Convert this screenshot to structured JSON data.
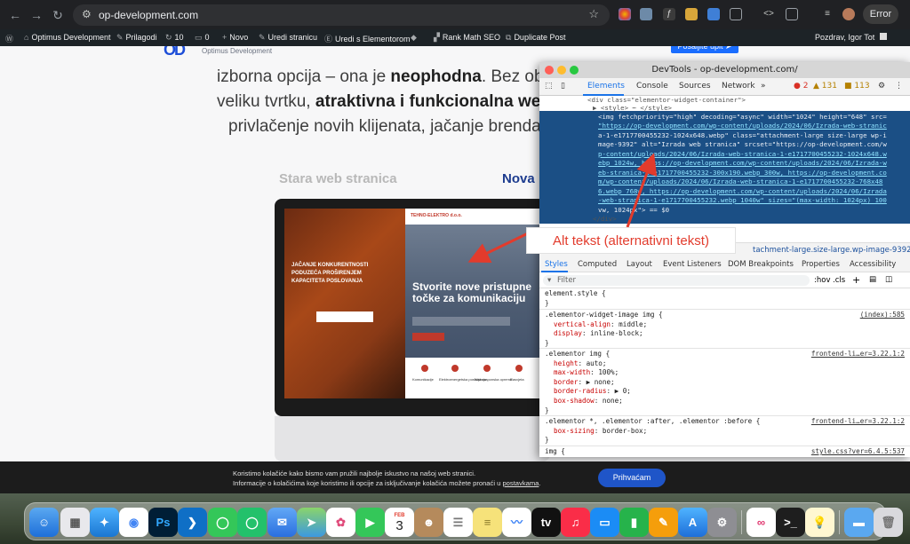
{
  "browser": {
    "url": "op-development.com",
    "profile_button": "Error"
  },
  "admin_bar": {
    "site_name": "Optimus Development",
    "customize": "Prilagodi",
    "updates_count": "10",
    "comments_count": "0",
    "new": "Novo",
    "edit_page": "Uredi stranicu",
    "edit_elementor": "Uredi s Elementorom",
    "rank_math": "Rank Math SEO",
    "duplicate": "Duplicate Post",
    "greeting": "Pozdrav, Igor Tot"
  },
  "page": {
    "logo_mark": "OD",
    "logo_sub": "Optimus Development",
    "cta_label": "Pošaljite upit ➤",
    "line1_a": "izborna opcija – ona je ",
    "line1_b": "neophodna",
    "line1_c": ". Bez obzi",
    "line2_a": "veliku tvrtku, ",
    "line2_b": "atraktivna i funkcionalna web",
    "line3": "privlačenje novih klijenata, jačanje brenda i",
    "col_old": "Stara web stranica",
    "col_new": "Nova",
    "old_site_text": "JAČANJE KONKURENTNOSTI PODUZEĆA PROŠIRENJEM KAPACITETA POSLOVANJA",
    "new_site_brand": "TEHNO-ELEKTRO d.o.o.",
    "new_site_heading": "Stvorite nove pristupne točke za komunikaciju",
    "new_site_icons": [
      "Komunikacije",
      "Elektroenergetska postrojenja",
      "Niskonaponska oprema",
      "Rasvjeta"
    ]
  },
  "devtools": {
    "title": "DevTools - op-development.com/",
    "tabs": [
      "Elements",
      "Console",
      "Sources",
      "Network"
    ],
    "more": "»",
    "errors": "2",
    "warnings": "131",
    "issues": "113",
    "dom_lines": [
      "<div class=\"elementor-widget-container\">",
      "▶ <style> ⋯ </style>",
      "<img fetchpriority=\"high\" decoding=\"async\" width=\"1024\" height=\"648\" src=",
      "\"https://op-development.com/wp-content/uploads/2024/06/Izrada-web-stranic",
      "a-1-e1717700455232-1024x648.webp\" class=\"attachment-large size-large wp-i",
      "mage-9392\" alt=\"Izrada web stranica\" srcset=\"https://op-development.com/w",
      "p-content/uploads/2024/06/Izrada-web-stranica-1-e1717700455232-1024x648.w",
      "ebp 1024w, https://op-development.com/wp-content/uploads/2024/06/Izrada-w",
      "eb-stranica-1-e1717700455232-300x190.webp 300w, https://op-development.co",
      "m/wp-content/uploads/2024/06/Izrada-web-stranica-1-e1717700455232-768x48",
      "6.webp 768w, https://op-development.com/wp-content/uploads/2024/06/Izrada",
      "-web-stranica-1-e1717700455232.webp 1040w\" sizes=\"(max-width: 1024px) 100",
      "vw, 1024px\"> == $0",
      "</div>"
    ],
    "breadcrumb": "tachment-large.size-large.wp-image-9392",
    "subtabs": [
      "Styles",
      "Computed",
      "Layout",
      "Event Listeners",
      "DOM Breakpoints",
      "Properties",
      "Accessibility"
    ],
    "filter_placeholder": "Filter",
    "filter_hov": ":hov",
    "filter_cls": ".cls",
    "styles": [
      {
        "selector": "element.style {",
        "source": "",
        "props": [],
        "close": "}"
      },
      {
        "selector": ".elementor-widget-image img {",
        "source": "(index):585",
        "props": [
          [
            "vertical-align",
            "middle;"
          ],
          [
            "display",
            "inline-block;"
          ]
        ],
        "close": "}"
      },
      {
        "selector": ".elementor img {",
        "source": "frontend-li…er=3.22.1:2",
        "props": [
          [
            "height",
            "auto;"
          ],
          [
            "max-width",
            "100%;"
          ],
          [
            "border",
            "▶ none;"
          ],
          [
            "border-radius",
            "▶ 0;"
          ],
          [
            "box-shadow",
            "none;"
          ]
        ],
        "close": "}"
      },
      {
        "selector": ".elementor *, .elementor :after, .elementor :before {",
        "source": "frontend-li…er=3.22.1:2",
        "props": [
          [
            "box-sizing",
            "border-box;"
          ]
        ],
        "close": "}"
      },
      {
        "selector": "img {",
        "source": "style.css?ver=6.4.5:537",
        "props": [],
        "close": ""
      }
    ]
  },
  "annotation": {
    "label": "Alt tekst (alternativni tekst)"
  },
  "cookie": {
    "line1": "Koristimo kolačiće kako bismo vam pružili najbolje iskustvo na našoj web stranici.",
    "line2": "Informacije o kolačićima koje koristimo ili opcije za isključivanje kolačića možete pronaći u ",
    "link": "postavkama",
    "line2_end": ".",
    "accept": "Prihvaćam"
  },
  "dock": {
    "calendar_month": "FEB",
    "calendar_day": "3"
  },
  "colors": {
    "accent": "#1a73e8",
    "annotation_red": "#e23b2c",
    "wp_bar": "#1d2327"
  }
}
